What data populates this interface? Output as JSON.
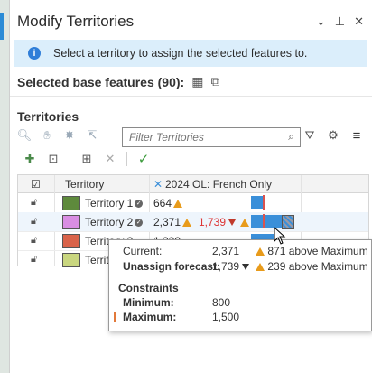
{
  "panel": {
    "title": "Modify Territories",
    "controls": [
      "⌄",
      "⊥",
      "✕"
    ],
    "info_message": "Select a territory to assign the selected features to.",
    "selected_base_label": "Selected base features (90):",
    "territories_label": "Territories",
    "filter_placeholder": "Filter Territories"
  },
  "grid": {
    "columns": [
      "Territory",
      "2024 OL: French Only"
    ],
    "rows": [
      {
        "name": "Territory 1",
        "value": "664",
        "extra": "",
        "color": "#5e8a3c",
        "bar_fraction": 0.44
      },
      {
        "name": "Territory 2",
        "value": "2,371",
        "extra": "1,739",
        "color": "#d98ee3",
        "bar_fraction": 1.0
      },
      {
        "name": "Territory 3",
        "value": "1,338",
        "extra": "",
        "color": "#d9634a",
        "bar_fraction": 0.89
      },
      {
        "name": "Territory 4",
        "value": "",
        "extra": "",
        "color": "#c9d67f",
        "bar_fraction": 0
      }
    ]
  },
  "tooltip": {
    "current_label": "Current:",
    "current_value": "2,371",
    "current_note": "871 above Maximum",
    "forecast_label": "Unassign forecast:",
    "forecast_value": "1,739",
    "forecast_note": "239 above Maximum",
    "constraints_label": "Constraints",
    "min_label": "Minimum:",
    "min_value": "800",
    "max_label": "Maximum:",
    "max_value": "1,500"
  },
  "colors": {
    "accent": "#3a8fd9",
    "warning": "#e89b1b",
    "alert": "#d33333",
    "info_bg": "#dbeefb"
  }
}
